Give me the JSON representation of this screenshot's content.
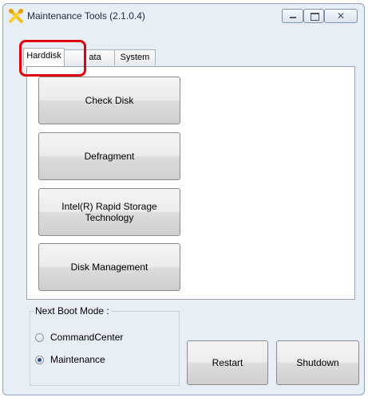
{
  "window": {
    "title": "Maintenance Tools (2.1.0.4)",
    "caption_close": "✕"
  },
  "tabs": [
    {
      "label": "Harddisk",
      "selected": true
    },
    {
      "label": "ata",
      "selected": false
    },
    {
      "label": "System",
      "selected": false
    }
  ],
  "actions": {
    "check_disk": "Check Disk",
    "defragment": "Defragment",
    "rst_line1": "Intel(R) Rapid Storage",
    "rst_line2": "Technology",
    "disk_management": "Disk Management"
  },
  "boot_mode": {
    "label": "Next Boot Mode :",
    "options": [
      {
        "label": "CommandCenter",
        "selected": false
      },
      {
        "label": "Maintenance",
        "selected": true
      }
    ]
  },
  "buttons": {
    "restart": "Restart",
    "shutdown": "Shutdown"
  },
  "colors": {
    "highlight": "#e1000f",
    "window_bg": "#e8eef6"
  }
}
